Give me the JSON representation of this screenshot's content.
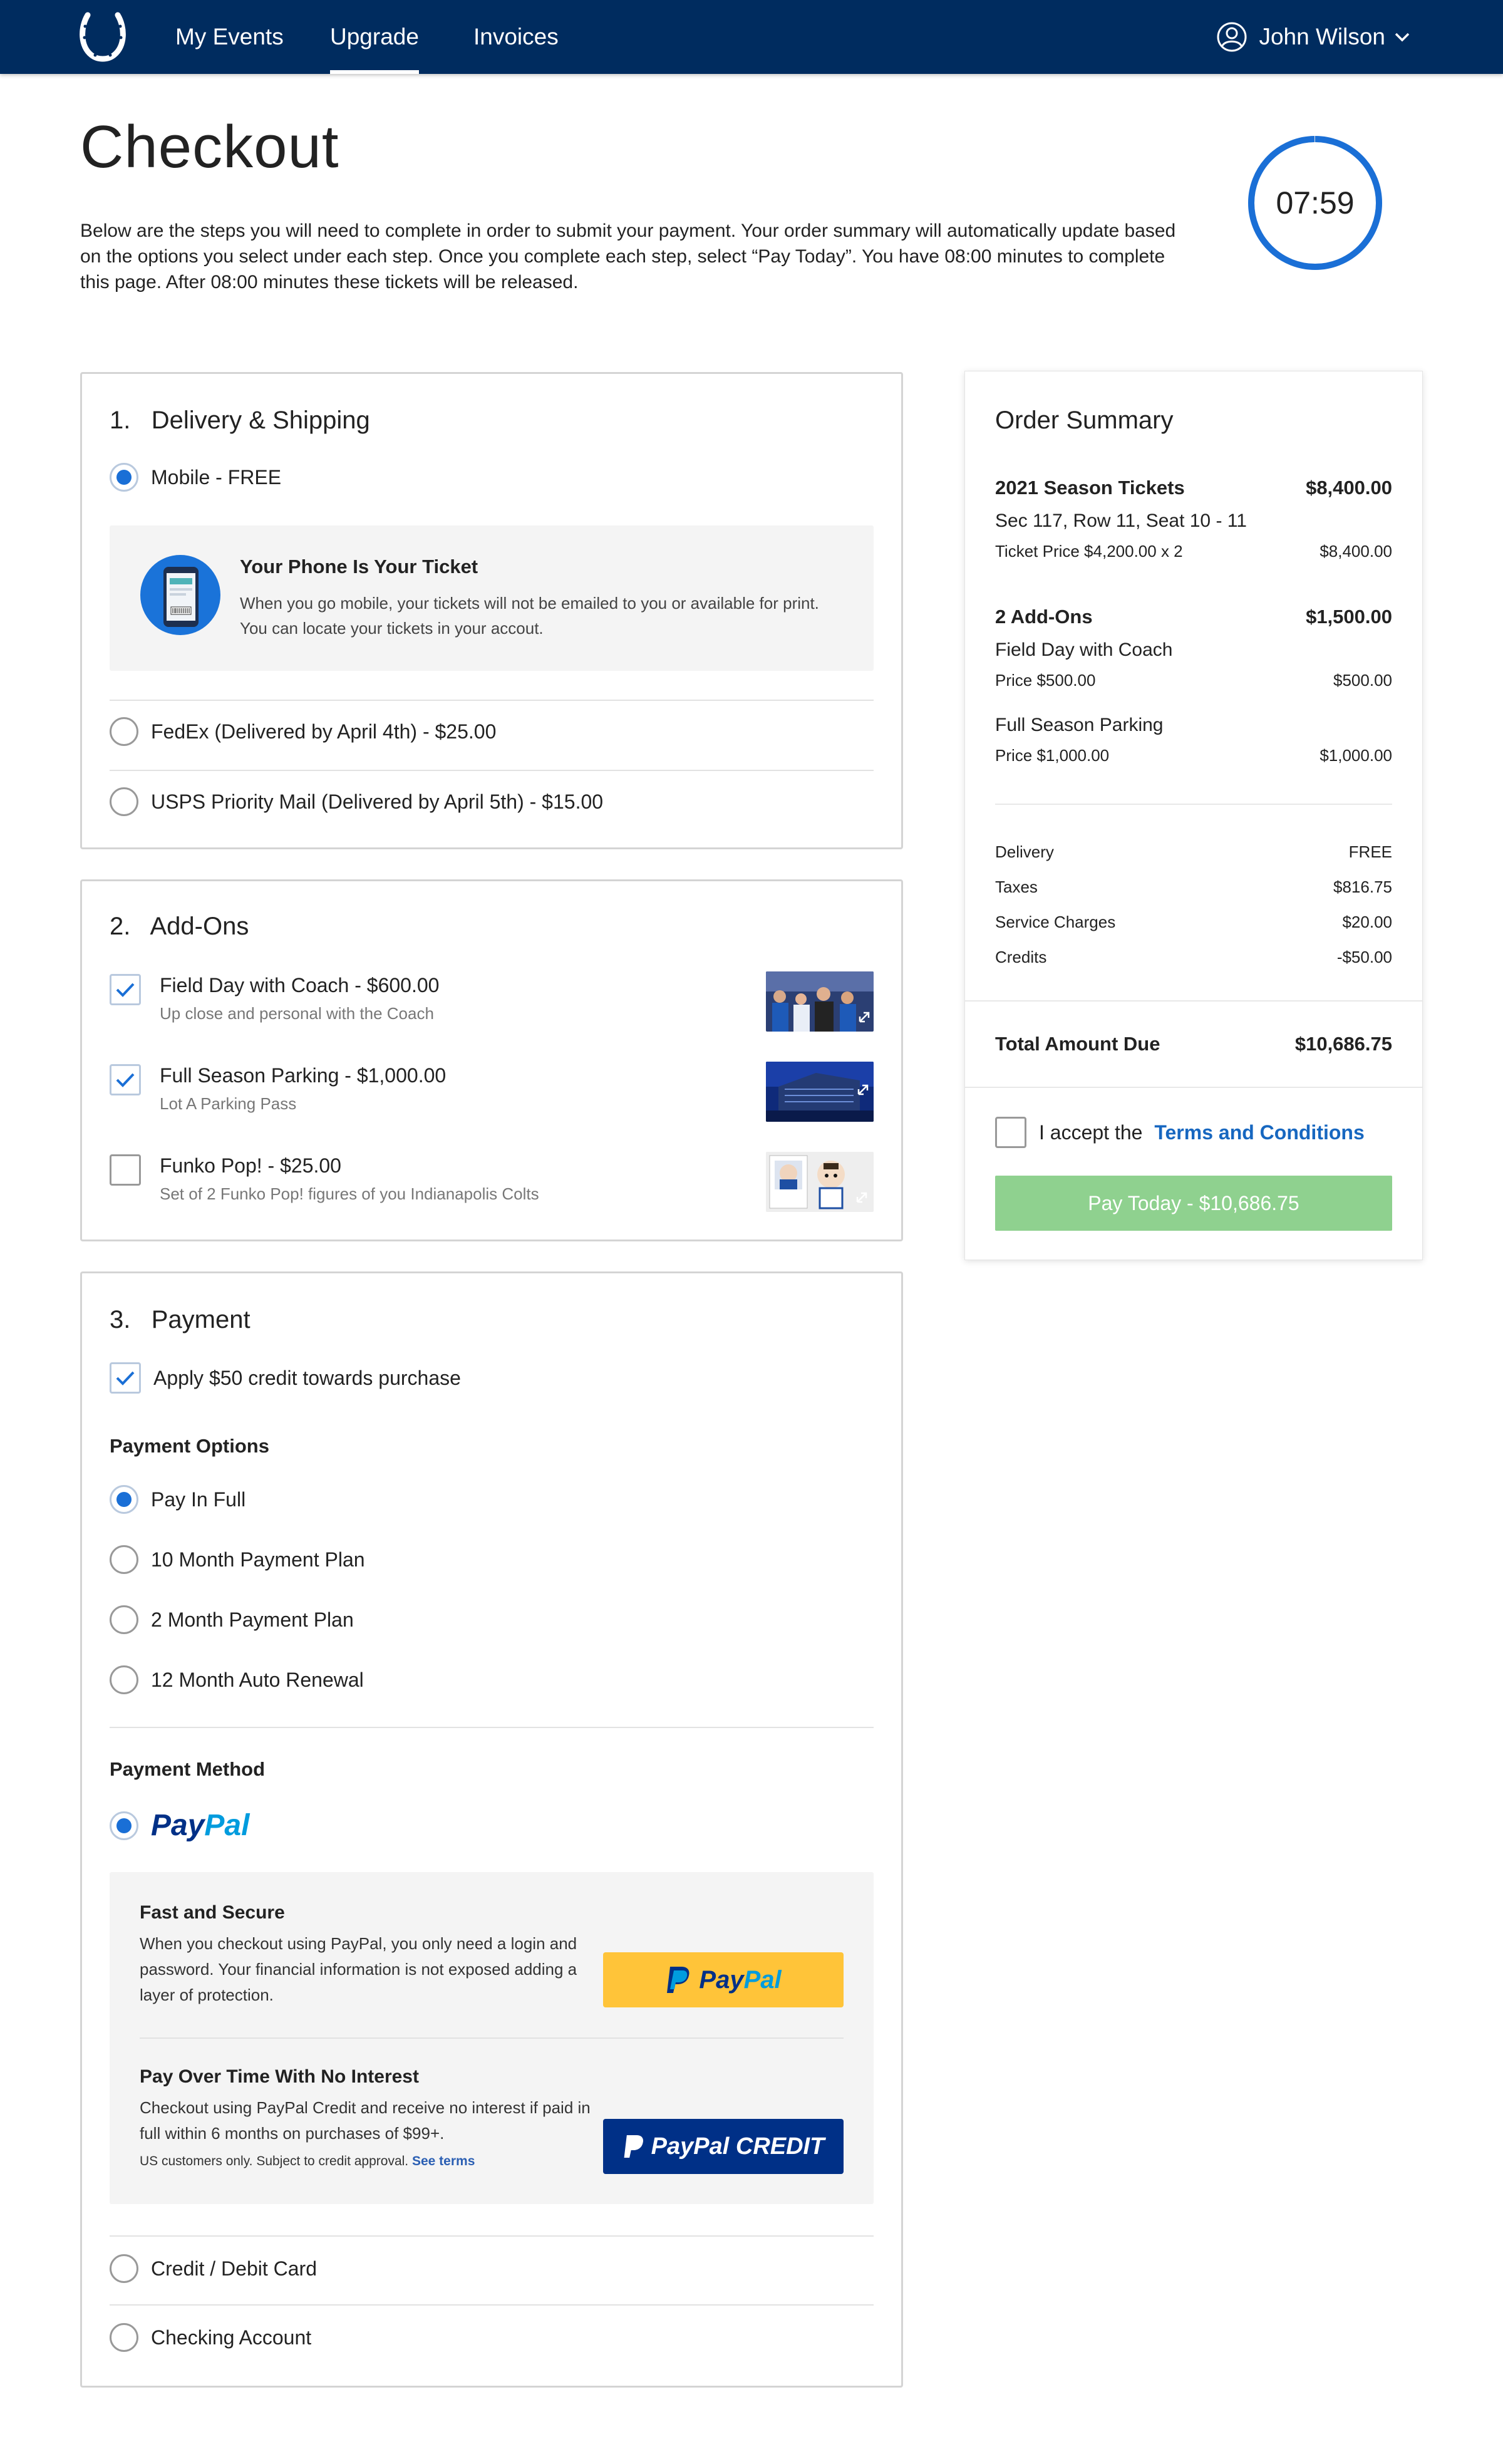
{
  "nav": {
    "tabs": [
      {
        "label": "My Events"
      },
      {
        "label": "Upgrade"
      },
      {
        "label": "Invoices"
      }
    ],
    "user_name": "John Wilson",
    "active_tab": "Upgrade"
  },
  "header": {
    "title": "Checkout",
    "intro": "Below are the steps you will need to complete in order to submit your payment. Your order summary will automatically update based on the options you select under each step. Once you complete each step, select “Pay Today”. You have 08:00 minutes to complete this page. After 08:00 minutes these tickets will be released.",
    "timer": "07:59",
    "timer_remaining_fraction": 0.998
  },
  "delivery": {
    "title": "1.   Delivery & Shipping",
    "options": [
      {
        "label": "Mobile - FREE",
        "selected": true
      },
      {
        "label": "FedEx (Delivered by April 4th) - $25.00",
        "selected": false
      },
      {
        "label": "USPS Priority Mail (Delivered by April 5th) - $15.00",
        "selected": false
      }
    ],
    "mobile_info": {
      "title": "Your Phone Is Your Ticket",
      "text": "When you go mobile, your tickets will not be emailed to you or available for print. You can locate your tickets in your accout."
    }
  },
  "addons": {
    "title": "2.   Add-Ons",
    "items": [
      {
        "title": "Field Day with Coach - $600.00",
        "subtitle": "Up close and personal with the Coach",
        "checked": true
      },
      {
        "title": "Full Season Parking - $1,000.00",
        "subtitle": "Lot A Parking Pass",
        "checked": true
      },
      {
        "title": "Funko Pop! - $25.00",
        "subtitle": "Set of 2 Funko Pop! figures of you Indianapolis Colts",
        "checked": false
      }
    ]
  },
  "payment": {
    "title": "3.   Payment",
    "credit_label": "Apply $50 credit towards purchase",
    "credit_checked": true,
    "options_heading": "Payment Options",
    "options": [
      {
        "label": "Pay In Full",
        "selected": true
      },
      {
        "label": "10 Month Payment Plan",
        "selected": false
      },
      {
        "label": "2 Month Payment Plan",
        "selected": false
      },
      {
        "label": "12 Month Auto Renewal",
        "selected": false
      }
    ],
    "method_heading": "Payment Method",
    "paypal": {
      "logo_text_pay": "Pay",
      "logo_text_pal": "Pal",
      "fast_title": "Fast and Secure",
      "fast_text": "When you checkout using PayPal, you only need a login and password. Your financial information is not exposed adding a layer of protection.",
      "button_pay": "Pay",
      "button_pal": "Pal",
      "credit_title": "Pay Over Time With No Interest",
      "credit_text": "Checkout using PayPal Credit and receive no interest if paid in full within 6 months on purchases of $99+.",
      "credit_fine": "US customers only. Subject to credit approval.",
      "credit_link": "See terms",
      "credit_button": "PayPal CREDIT"
    },
    "other_methods": [
      {
        "label": "Credit / Debit Card",
        "selected": false
      },
      {
        "label": "Checking Account",
        "selected": false
      }
    ]
  },
  "summary": {
    "title": "Order Summary",
    "tickets": {
      "label": "2021 Season Tickets",
      "amount": "$8,400.00",
      "seat": "Sec 117, Row 11, Seat 10 - 11",
      "price_line": "Ticket Price $4,200.00 x 2",
      "price_amount": "$8,400.00"
    },
    "addons": {
      "label": "2 Add-Ons",
      "amount": "$1,500.00",
      "items": [
        {
          "name": "Field Day with Coach",
          "price_line": "Price $500.00",
          "price_amount": "$500.00"
        },
        {
          "name": "Full Season Parking",
          "price_line": "Price $1,000.00",
          "price_amount": "$1,000.00"
        }
      ]
    },
    "fees": [
      {
        "label": "Delivery",
        "value": "FREE"
      },
      {
        "label": "Taxes",
        "value": "$816.75"
      },
      {
        "label": "Service Charges",
        "value": "$20.00"
      },
      {
        "label": "Credits",
        "value": "-$50.00"
      }
    ],
    "total_label": "Total Amount Due",
    "total_value": "$10,686.75",
    "terms_prefix": "I accept the ",
    "terms_link": "Terms and Conditions",
    "terms_checked": false,
    "pay_button": "Pay Today - $10,686.75"
  },
  "colors": {
    "nav_bg": "#002c5f",
    "accent_blue": "#1a6fd6",
    "pay_button_disabled": "#8fd18f",
    "paypal_yellow": "#ffc439",
    "paypal_credit_navy": "#003087"
  }
}
